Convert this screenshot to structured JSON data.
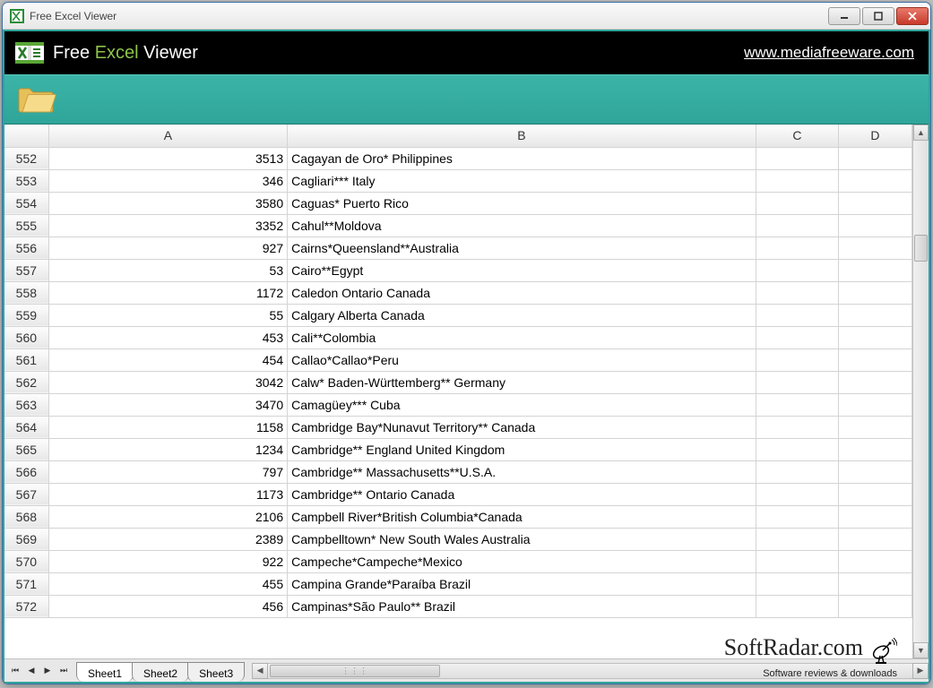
{
  "window": {
    "title": "Free Excel Viewer"
  },
  "brand": {
    "title_pre": "Free ",
    "title_green": "Excel",
    "title_post": " Viewer",
    "url": "www.mediafreeware.com"
  },
  "columns": [
    "",
    "A",
    "B",
    "C",
    "D"
  ],
  "rows": [
    {
      "n": "552",
      "a": "3513",
      "b": "Cagayan de Oro* Philippines"
    },
    {
      "n": "553",
      "a": "346",
      "b": "Cagliari*** Italy"
    },
    {
      "n": "554",
      "a": "3580",
      "b": "Caguas* Puerto Rico"
    },
    {
      "n": "555",
      "a": "3352",
      "b": "Cahul**Moldova"
    },
    {
      "n": "556",
      "a": "927",
      "b": "Cairns*Queensland**Australia"
    },
    {
      "n": "557",
      "a": "53",
      "b": "Cairo**Egypt"
    },
    {
      "n": "558",
      "a": "1172",
      "b": "Caledon Ontario Canada"
    },
    {
      "n": "559",
      "a": "55",
      "b": "Calgary Alberta Canada"
    },
    {
      "n": "560",
      "a": "453",
      "b": "Cali**Colombia"
    },
    {
      "n": "561",
      "a": "454",
      "b": "Callao*Callao*Peru"
    },
    {
      "n": "562",
      "a": "3042",
      "b": "Calw* Baden-Württemberg** Germany"
    },
    {
      "n": "563",
      "a": "3470",
      "b": "Camagüey*** Cuba"
    },
    {
      "n": "564",
      "a": "1158",
      "b": "Cambridge Bay*Nunavut Territory** Canada"
    },
    {
      "n": "565",
      "a": "1234",
      "b": "Cambridge** England United Kingdom"
    },
    {
      "n": "566",
      "a": "797",
      "b": "Cambridge** Massachusetts**U.S.A."
    },
    {
      "n": "567",
      "a": "1173",
      "b": "Cambridge** Ontario Canada"
    },
    {
      "n": "568",
      "a": "2106",
      "b": "Campbell River*British Columbia*Canada"
    },
    {
      "n": "569",
      "a": "2389",
      "b": "Campbelltown* New South Wales Australia"
    },
    {
      "n": "570",
      "a": "922",
      "b": "Campeche*Campeche*Mexico"
    },
    {
      "n": "571",
      "a": "455",
      "b": "Campina Grande*Paraíba Brazil"
    },
    {
      "n": "572",
      "a": "456",
      "b": "Campinas*São Paulo** Brazil"
    }
  ],
  "sheets": {
    "tabs": [
      "Sheet1",
      "Sheet2",
      "Sheet3"
    ],
    "active": 0
  },
  "watermark": {
    "big": "SoftRadar.com",
    "small": "Software reviews & downloads"
  }
}
